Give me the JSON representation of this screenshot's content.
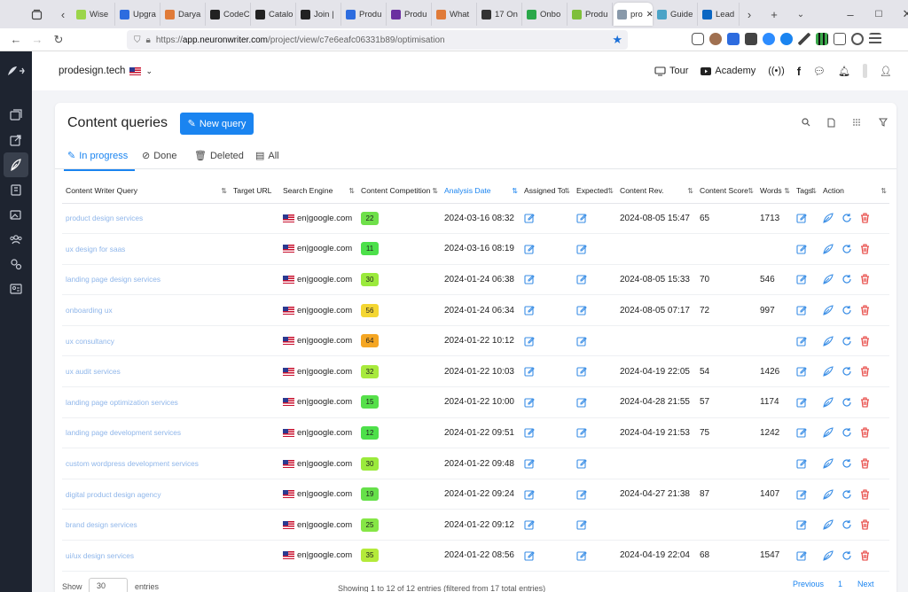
{
  "browser": {
    "tabs": [
      {
        "label": "Wise",
        "color": "#9bd54a"
      },
      {
        "label": "Upgra",
        "color": "#2d6cdf"
      },
      {
        "label": "Darya",
        "color": "#e07b39"
      },
      {
        "label": "CodeC",
        "color": "#222222"
      },
      {
        "label": "Catalo",
        "color": "#222222"
      },
      {
        "label": "Join |",
        "color": "#222222"
      },
      {
        "label": "Produ",
        "color": "#2d6cdf"
      },
      {
        "label": "Produ",
        "color": "#6b2fa0"
      },
      {
        "label": "What",
        "color": "#e07b39"
      },
      {
        "label": "17 On",
        "color": "#333333"
      },
      {
        "label": "Onbo",
        "color": "#2aa84a"
      },
      {
        "label": "Produ",
        "color": "#7fbf3a"
      },
      {
        "label": "pro",
        "color": "#8899aa",
        "active": true
      },
      {
        "label": "Guide",
        "color": "#4ba3c7"
      },
      {
        "label": "Lead",
        "color": "#0a66c2"
      }
    ],
    "url_prefix": "https://",
    "url_host": "app.neuronwriter.com",
    "url_path": "/project/view/c7e6eafc06331b89/optimisation"
  },
  "header": {
    "site": "prodesign.tech",
    "tour": "Tour",
    "academy": "Academy"
  },
  "card": {
    "title": "Content queries",
    "new_query": "New query"
  },
  "filter_tabs": [
    "In progress",
    "Done",
    "Deleted",
    "All"
  ],
  "table": {
    "columns": [
      "Content Writer Query",
      "Target URL",
      "Search Engine",
      "Content Competition",
      "Analysis Date",
      "Assigned To",
      "Expected",
      "Content Rev.",
      "Content Score",
      "Words",
      "Tags",
      "Action"
    ],
    "rows": [
      {
        "query": "product design services",
        "engine": "en|google.com",
        "comp": "22",
        "comp_color": "#6fe04a",
        "date": "2024-03-16 08:32",
        "rev": "2024-08-05 15:47",
        "score": "65",
        "words": "1713"
      },
      {
        "query": "ux design for saas",
        "engine": "en|google.com",
        "comp": "11",
        "comp_color": "#4ce04a",
        "date": "2024-03-16 08:19",
        "rev": "",
        "score": "",
        "words": ""
      },
      {
        "query": "landing page design services",
        "engine": "en|google.com",
        "comp": "30",
        "comp_color": "#9bea3c",
        "date": "2024-01-24 06:38",
        "rev": "2024-08-05 15:33",
        "score": "70",
        "words": "546"
      },
      {
        "query": "onboarding ux",
        "engine": "en|google.com",
        "comp": "56",
        "comp_color": "#f4d632",
        "date": "2024-01-24 06:34",
        "rev": "2024-08-05 07:17",
        "score": "72",
        "words": "997"
      },
      {
        "query": "ux consultancy",
        "engine": "en|google.com",
        "comp": "64",
        "comp_color": "#f5a623",
        "date": "2024-01-22 10:12",
        "rev": "",
        "score": "",
        "words": ""
      },
      {
        "query": "ux audit services",
        "engine": "en|google.com",
        "comp": "32",
        "comp_color": "#a8ea3c",
        "date": "2024-01-22 10:03",
        "rev": "2024-04-19 22:05",
        "score": "54",
        "words": "1426"
      },
      {
        "query": "landing page optimization services",
        "engine": "en|google.com",
        "comp": "15",
        "comp_color": "#56e04a",
        "date": "2024-01-22 10:00",
        "rev": "2024-04-28 21:55",
        "score": "57",
        "words": "1174"
      },
      {
        "query": "landing page development services",
        "engine": "en|google.com",
        "comp": "12",
        "comp_color": "#4ee04a",
        "date": "2024-01-22 09:51",
        "rev": "2024-04-19 21:53",
        "score": "75",
        "words": "1242"
      },
      {
        "query": "custom wordpress development services",
        "engine": "en|google.com",
        "comp": "30",
        "comp_color": "#9bea3c",
        "date": "2024-01-22 09:48",
        "rev": "",
        "score": "",
        "words": ""
      },
      {
        "query": "digital product design agency",
        "engine": "en|google.com",
        "comp": "19",
        "comp_color": "#66e04a",
        "date": "2024-01-22 09:24",
        "rev": "2024-04-27 21:38",
        "score": "87",
        "words": "1407"
      },
      {
        "query": "brand design services",
        "engine": "en|google.com",
        "comp": "25",
        "comp_color": "#86e646",
        "date": "2024-01-22 09:12",
        "rev": "",
        "score": "",
        "words": ""
      },
      {
        "query": "ui/ux design services",
        "engine": "en|google.com",
        "comp": "35",
        "comp_color": "#b4ea3a",
        "date": "2024-01-22 08:56",
        "rev": "2024-04-19 22:04",
        "score": "68",
        "words": "1547"
      }
    ]
  },
  "footer": {
    "show": "Show",
    "page_size": "30",
    "entries": "entries",
    "info": "Showing 1 to 12 of 12 entries (filtered from 17 total entries)",
    "previous": "Previous",
    "page": "1",
    "next": "Next"
  }
}
